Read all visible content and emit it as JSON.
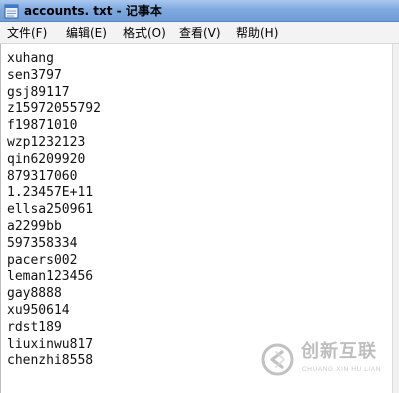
{
  "window": {
    "title": "accounts. txt - 记事本"
  },
  "menu": [
    {
      "label": "文件(F)"
    },
    {
      "label": "编辑(E)"
    },
    {
      "label": "格式(O)"
    },
    {
      "label": "查看(V)"
    },
    {
      "label": "帮助(H)"
    }
  ],
  "document": {
    "lines": [
      "xuhang",
      "sen3797",
      "gsj89117",
      "z15972055792",
      "f19871010",
      "wzp1232123",
      "qin6209920",
      "879317060",
      "1.23457E+11",
      "ellsa250961",
      "a2299bb",
      "597358334",
      "pacers002",
      "leman123456",
      "gay8888",
      "xu950614",
      "rdst189",
      "liuxinwu817",
      "chenzhi8558"
    ]
  },
  "watermark": {
    "brand": "创新互联",
    "sub": "CHUANG XIN HU LIAN"
  },
  "colors": {
    "titlebar": "#7fa9de",
    "menubar": "#f3f3f3",
    "text": "#111111"
  }
}
